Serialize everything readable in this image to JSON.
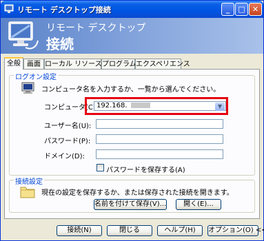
{
  "window": {
    "title": "リモート デスクトップ接続",
    "banner_line1": "リモート デスクトップ",
    "banner_line2": "接続"
  },
  "tabs": [
    "全般",
    "画面",
    "ローカル リソース",
    "プログラム",
    "エクスペリエンス"
  ],
  "logon": {
    "legend": "ログオン設定",
    "instruction": "コンピュータ名を入力するか、一覧から選んでください。",
    "computer_label": "コンピュータ(C):",
    "computer_value": "192.168.",
    "username_label": "ユーザー名(U):",
    "password_label": "パスワード(P):",
    "domain_label": "ドメイン(D):",
    "save_password_label": "パスワードを保存する(A)"
  },
  "connection_settings": {
    "legend": "接続設定",
    "description": "現在の設定を保存するか、または保存された接続を開きます。",
    "save_as_label": "名前を付けて保存(V)...",
    "open_label": "開く(E)..."
  },
  "buttons": {
    "connect": "接続(N)",
    "close": "閉じる",
    "help": "ヘルプ(H)",
    "options": "オプション(O) <<"
  },
  "colors": {
    "highlight_box": "#e60012",
    "titlebar": "#0054e3",
    "group_legend": "#0046d5"
  }
}
